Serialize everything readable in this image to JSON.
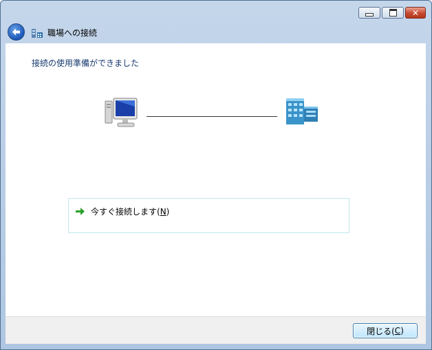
{
  "window": {
    "title": "職場への接続",
    "controls": {
      "minimize_icon": "minimize-icon",
      "maximize_icon": "maximize-icon",
      "close_icon": "close-icon"
    }
  },
  "nav": {
    "back_icon": "back-arrow-icon",
    "app_icon": "workplace-network-icon"
  },
  "main": {
    "heading": "接続の使用準備ができました",
    "diagram": {
      "left_icon": "computer-icon",
      "right_icon": "server-building-icon"
    },
    "connect_now": {
      "icon": "green-arrow-icon",
      "label_prefix": "今すぐ接続します(",
      "mnemonic": "N",
      "label_suffix": ")"
    }
  },
  "footer": {
    "close_button": {
      "label_prefix": "閉じる(",
      "mnemonic": "C",
      "label_suffix": ")"
    }
  },
  "colors": {
    "heading": "#16386d",
    "frame": "#b9cfe8",
    "link_box_border": "#bfe8ea",
    "arrow": "#2aa02a"
  }
}
